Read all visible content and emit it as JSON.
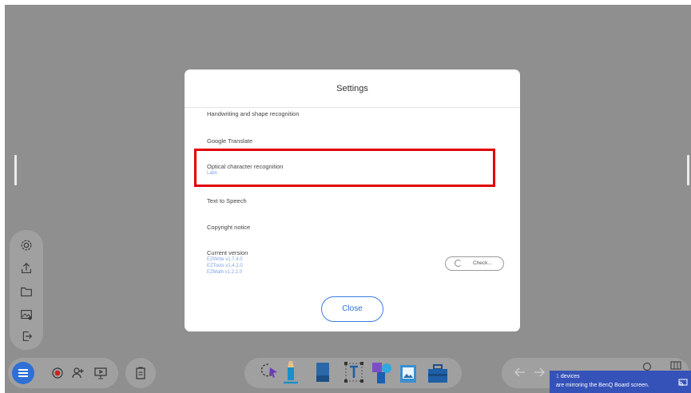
{
  "dialog": {
    "title": "Settings",
    "items": [
      {
        "label": "Handwriting and shape recognition"
      },
      {
        "label": "Google Translate"
      },
      {
        "label": "Optical character recognition",
        "sublabel": "Latin"
      },
      {
        "label": "Text to Speech"
      },
      {
        "label": "Copyright notice"
      },
      {
        "label": "Current version"
      }
    ],
    "versions": [
      "EZWrite v1.7.4.0",
      "EZTools v1.4.2.0",
      "EZMath v1.2.2.0"
    ],
    "check_label": "Check...",
    "close_label": "Close"
  },
  "toast": {
    "count": "1",
    "line1_suffix": " devices",
    "line2": "are mirroring the BenQ Board screen."
  },
  "colors": {
    "canvas": "#8f8f8f",
    "accent": "#2f6fd6",
    "highlight": "#e00000",
    "toast": "#3552b8"
  },
  "icons": {
    "left_panel": [
      "gear-icon",
      "upload-icon",
      "folder-icon",
      "background-image-icon",
      "exit-icon"
    ],
    "left_bar": [
      "menu-icon",
      "record-icon",
      "add-user-icon",
      "present-icon",
      "clipboard-icon"
    ],
    "center_tools": [
      "lasso-icon",
      "pen-icon",
      "eraser-icon",
      "text-icon",
      "shapes-icon",
      "image-icon",
      "toolbox-icon"
    ],
    "right_bar": [
      "undo-icon",
      "redo-icon",
      "page-icon",
      "grid-icon",
      "cast-icon"
    ]
  }
}
